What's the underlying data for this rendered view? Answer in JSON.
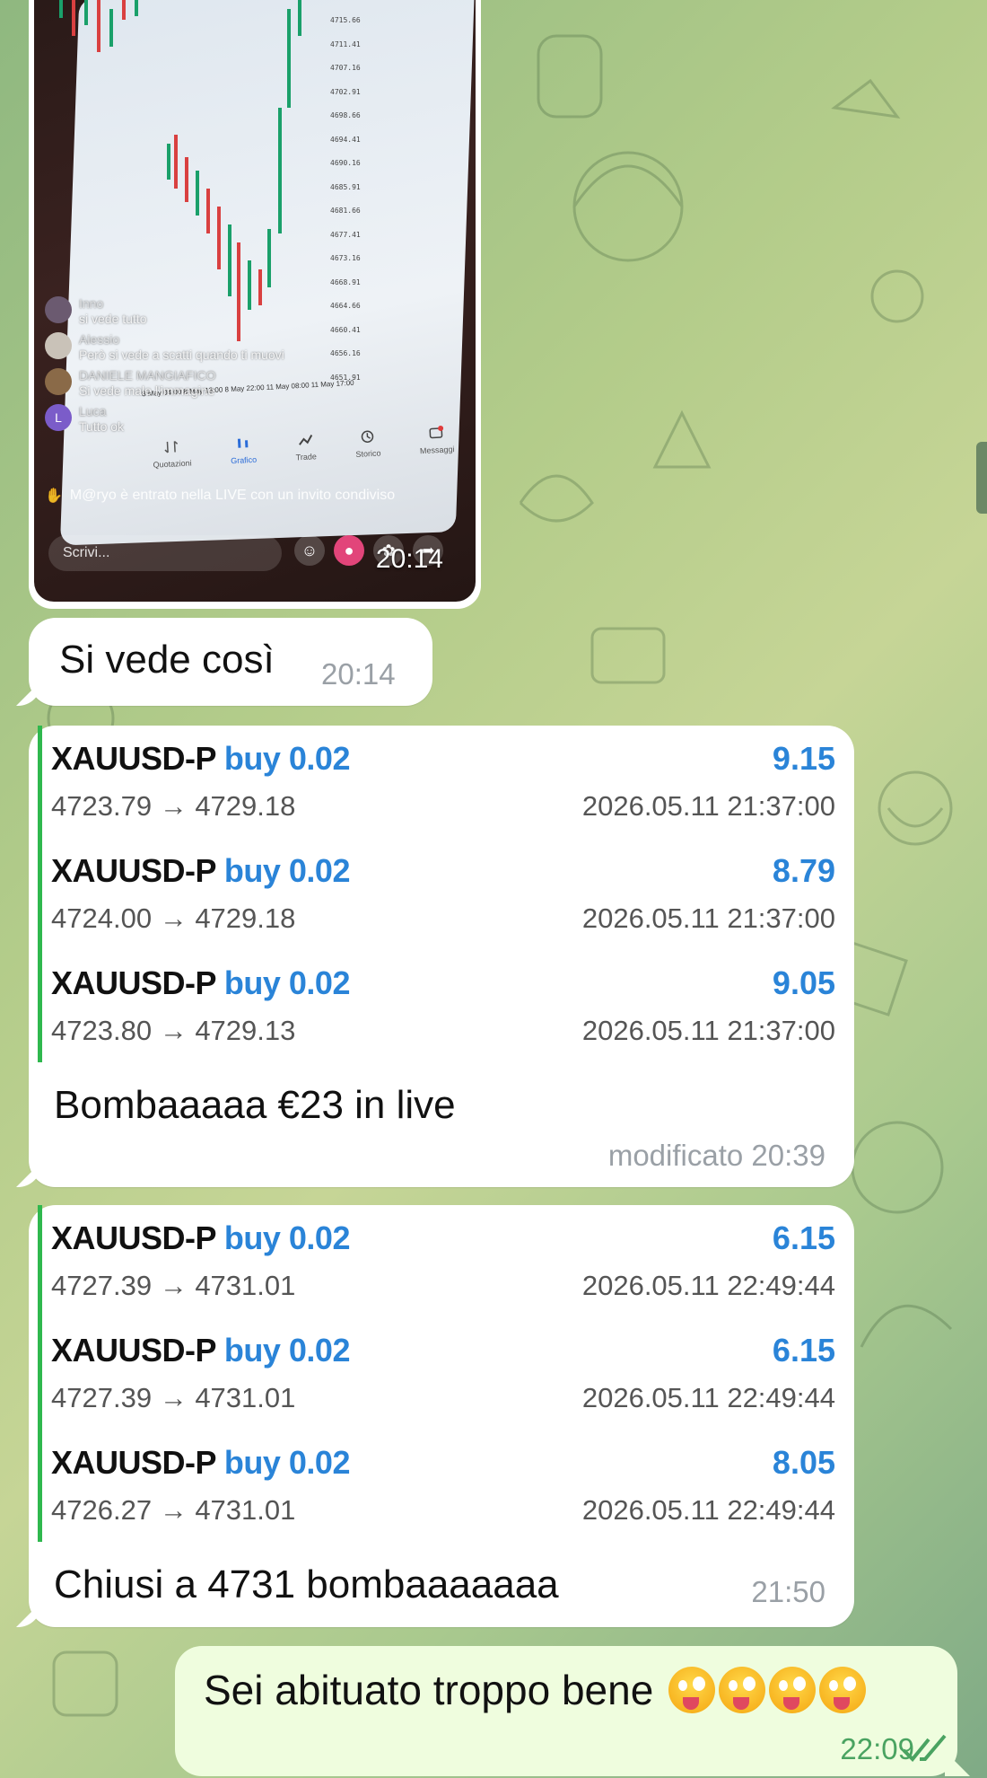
{
  "chat": {
    "image_message": {
      "time": "20:14",
      "price_scale": [
        "4715.66",
        "4711.41",
        "4707.16",
        "4702.91",
        "4698.66",
        "4694.41",
        "4690.16",
        "4685.91",
        "4681.66",
        "4677.41",
        "4673.16",
        "4668.91",
        "4664.66",
        "4660.41",
        "4656.16",
        "4651.91"
      ],
      "date_axis": "8 May 04:00   8 May 13:00   8 May 22:00   11 May 08:00   11 May 17:00",
      "live_comments": [
        {
          "name": "Inno",
          "text": "si vede tutto",
          "avatar_color": "#6b5a70"
        },
        {
          "name": "Alessio",
          "text": "Però si vede a scatti quando ti muovi",
          "avatar_color": "#c9c2b8"
        },
        {
          "name": "DANIELE MANGIAFICO",
          "text": "Si vede male l'immagine",
          "avatar_color": "#8a6a48"
        },
        {
          "name": "Luca",
          "text": "Tutto ok",
          "avatar_color": "#7b5cc9",
          "avatar_letter": "L"
        }
      ],
      "joined_notice": "M@ryo è entrato nella LIVE con un invito condiviso",
      "bottom_nav": [
        "Quotazioni",
        "Grafico",
        "Trade",
        "Storico",
        "Messaggi"
      ],
      "write_placeholder": "Scrivi..."
    },
    "msg_si_vede": {
      "text": "Si vede così",
      "time": "20:14"
    },
    "signals_1": {
      "trades": [
        {
          "symbol": "XAUUSD-P",
          "side": "buy 0.02",
          "profit": "9.15",
          "open": "4723.79",
          "close": "4729.18",
          "timestamp": "2026.05.11 21:37:00"
        },
        {
          "symbol": "XAUUSD-P",
          "side": "buy 0.02",
          "profit": "8.79",
          "open": "4724.00",
          "close": "4729.18",
          "timestamp": "2026.05.11 21:37:00"
        },
        {
          "symbol": "XAUUSD-P",
          "side": "buy 0.02",
          "profit": "9.05",
          "open": "4723.80",
          "close": "4729.13",
          "timestamp": "2026.05.11 21:37:00"
        }
      ],
      "caption": "Bombaaaaa €23 in live",
      "time": "modificato 20:39"
    },
    "signals_2": {
      "trades": [
        {
          "symbol": "XAUUSD-P",
          "side": "buy 0.02",
          "profit": "6.15",
          "open": "4727.39",
          "close": "4731.01",
          "timestamp": "2026.05.11 22:49:44"
        },
        {
          "symbol": "XAUUSD-P",
          "side": "buy 0.02",
          "profit": "6.15",
          "open": "4727.39",
          "close": "4731.01",
          "timestamp": "2026.05.11 22:49:44"
        },
        {
          "symbol": "XAUUSD-P",
          "side": "buy 0.02",
          "profit": "8.05",
          "open": "4726.27",
          "close": "4731.01",
          "timestamp": "2026.05.11 22:49:44"
        }
      ],
      "caption": "Chiusi a 4731 bombaaaaaaa",
      "time": "21:50"
    },
    "outgoing": {
      "text": "Sei abituato troppo bene",
      "emoji_count": 4,
      "time": "22:09",
      "read_status": "double-check-icon"
    },
    "colors": {
      "buy": "#2a84d8",
      "profit": "#2a84d8",
      "accent_bar": "#2fb84e",
      "outgoing_bg": "#effdde",
      "outgoing_time": "#4aa361"
    }
  }
}
